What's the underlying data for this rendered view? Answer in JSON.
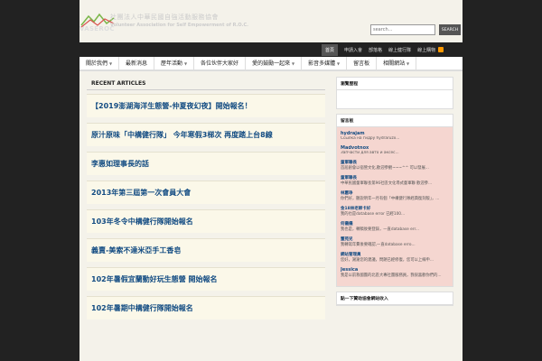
{
  "header": {
    "logo_text": "VASEROC",
    "org_cn": "社團法人中華民國自強活動服務協會",
    "org_en": "Volunteer Association for Self Empowerment of R.O.C.",
    "search_placeholder": "search...",
    "search_button": "SEARCH"
  },
  "topbar": {
    "links": [
      "首頁",
      "申請入會",
      "部落格",
      "線上健行隊",
      "線上購物"
    ]
  },
  "nav": {
    "items": [
      "關於我們",
      "最新消息",
      "歷年活動",
      "各位伙伴大家好",
      "愛的鼓勵一起來",
      "影音多媒體",
      "留言板",
      "相關網站"
    ]
  },
  "articles": {
    "section_title": "RECENT ARTICLES",
    "items": [
      "【2019澎湖海洋生態營-仲夏夜幻夜】開始報名！",
      "原汁原味「中構健行隊」 今年寒假3梯次 再度踏上台8線",
      "李惠如理事長的話",
      "2013年第三屆第一次會員大會",
      "103年冬令中構健行隊開始報名",
      "義賣-美索不達米亞手工香皂",
      "102年暑假宜蘭動好玩生態營 開始報名",
      "102年暑期中構健行隊開始報名"
    ]
  },
  "sidebar": {
    "box1_title": "瀏覽歷程",
    "box2_title": "留言板",
    "comments": [
      {
        "author": "hydrajam",
        "text": "Ссылка на гидру hydraruzx..."
      },
      {
        "author": "Madvotnox",
        "text": "Запчасти для авто и аксес..."
      },
      {
        "author": "童軍聯長",
        "text": "首屆創會以宿營文化,歡迎參觀~~~^^ 可以發展..."
      },
      {
        "author": "童軍聯長",
        "text": "中華民國童軍聯長第96社區文化尋式童軍聯 歡迎參..."
      },
      {
        "author": "林蕙琤",
        "text": "你們好，聽說明年一月有個「中構健行隊經典復刻版」，..."
      },
      {
        "author": "金18林老師卡好",
        "text": "我的也是database error 已經100..."
      },
      {
        "author": "何儀儀",
        "text": "我也是，轉稿後要登錄，一直database err..."
      },
      {
        "author": "董苑兒",
        "text": "我轉寫年費後要確認,一直database erro..."
      },
      {
        "author": "網站管理員",
        "text": "您好，謝謝您的建議，問題已經修復，您可以上線申..."
      },
      {
        "author": "Jessica",
        "text": "我是以前救國團的北區大專社團服務員，我很喜歡你們的..."
      }
    ],
    "box3_title": "點一下贊助協會網站收入"
  }
}
